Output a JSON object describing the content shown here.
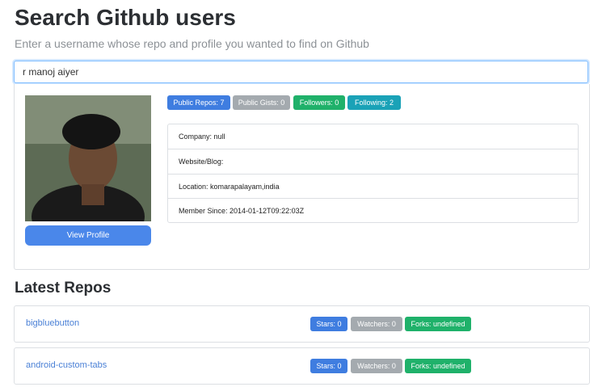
{
  "header": {
    "title": "Search Github users",
    "subtitle": "Enter a username whose repo and profile you wanted to find on Github"
  },
  "search": {
    "value": "r manoj aiyer",
    "placeholder": ""
  },
  "profile": {
    "view_profile_label": "View Profile",
    "badges": {
      "public_repos": "Public Repos: 7",
      "public_gists": "Public Gists: 0",
      "followers": "Followers: 0",
      "following": "Following: 2"
    },
    "details": {
      "company": "Company: null",
      "website": "Website/Blog:",
      "location": "Location: komarapalayam,india",
      "member_since": "Member Since: 2014-01-12T09:22:03Z"
    }
  },
  "repos_section": {
    "title": "Latest Repos"
  },
  "repos": [
    {
      "name": "bigbluebutton",
      "stars": "Stars: 0",
      "watchers": "Watchers: 0",
      "forks": "Forks: undefined"
    },
    {
      "name": "android-custom-tabs",
      "stars": "Stars: 0",
      "watchers": "Watchers: 0",
      "forks": "Forks: undefined"
    }
  ],
  "colors": {
    "primary": "#3f7de0",
    "secondary": "#a4aaaf",
    "success": "#1fb16a",
    "info": "#1aa2b7"
  }
}
